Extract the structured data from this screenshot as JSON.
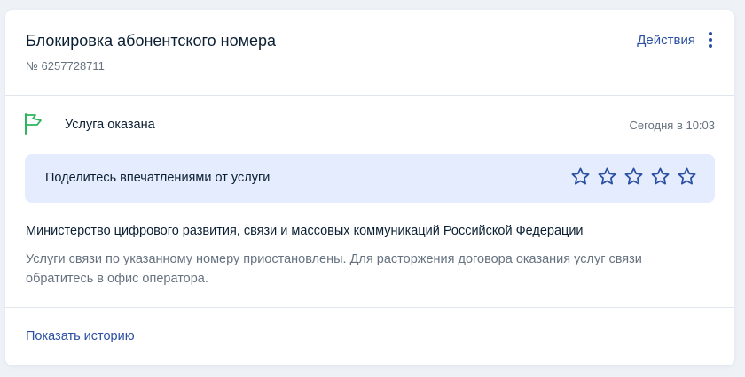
{
  "header": {
    "title": "Блокировка абонентского номера",
    "order_number": "№ 6257728711",
    "actions_label": "Действия"
  },
  "status": {
    "icon": "flag-icon",
    "text": "Услуга оказана",
    "time": "Сегодня в 10:03",
    "icon_color": "#2fb35f"
  },
  "rating": {
    "prompt": "Поделитесь впечатлениями от услуги",
    "stars_total": 5,
    "stars_selected": 0,
    "star_color": "#2a4fa3",
    "background": "#e4ecfd"
  },
  "body": {
    "organization": "Министерство цифрового развития, связи и массовых коммуникаций Российской Федерации",
    "description": "Услуги связи по указанному номеру приостановлены. Для расторжения договора оказания услуг связи обратитесь в офис оператора."
  },
  "footer": {
    "history_link": "Показать историю"
  },
  "colors": {
    "accent": "#2a4fa3",
    "text_primary": "#0b1f33",
    "text_secondary": "#66727f"
  }
}
